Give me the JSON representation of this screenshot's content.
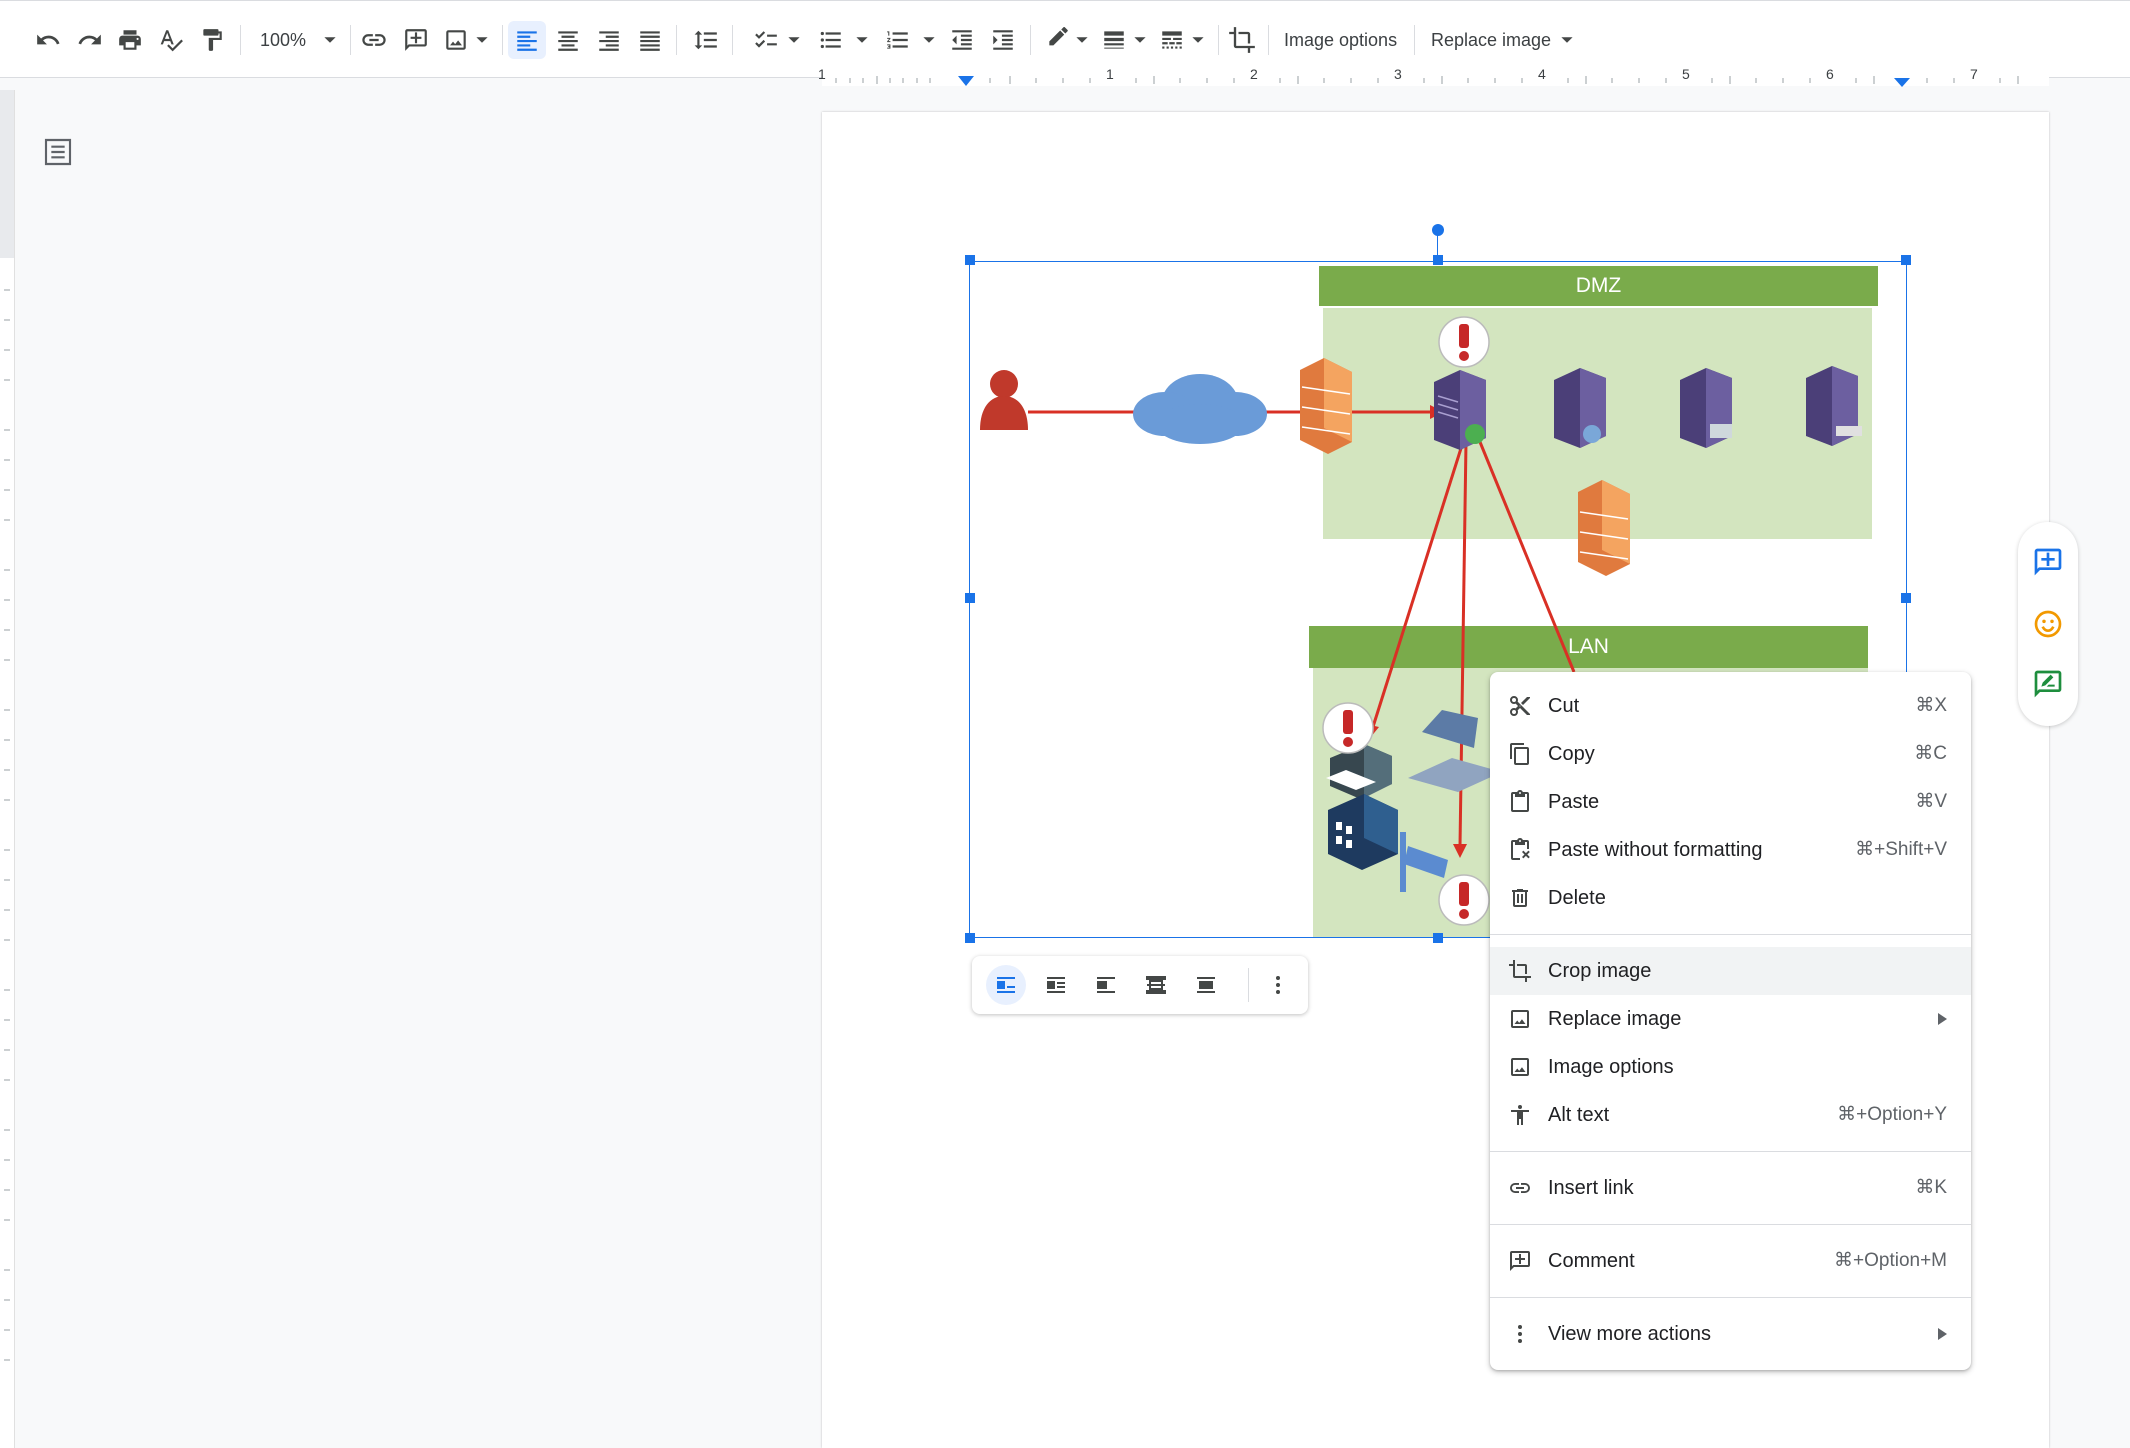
{
  "toolbar": {
    "zoom": "100%",
    "image_options_label": "Image options",
    "replace_image_label": "Replace image"
  },
  "ruler": {
    "numbers": [
      "1",
      "1",
      "2",
      "3",
      "4",
      "5",
      "6",
      "7"
    ]
  },
  "diagram": {
    "dmz_label": "DMZ",
    "lan_label": "LAN"
  },
  "context_menu": {
    "items": [
      {
        "label": "Cut",
        "shortcut": "⌘X",
        "icon": "scissors-icon"
      },
      {
        "label": "Copy",
        "shortcut": "⌘C",
        "icon": "copy-icon"
      },
      {
        "label": "Paste",
        "shortcut": "⌘V",
        "icon": "clipboard-icon"
      },
      {
        "label": "Paste without formatting",
        "shortcut": "⌘+Shift+V",
        "icon": "clipboard-clear-icon"
      },
      {
        "label": "Delete",
        "shortcut": "",
        "icon": "trash-icon"
      },
      {
        "label": "Crop image",
        "shortcut": "",
        "icon": "crop-icon"
      },
      {
        "label": "Replace image",
        "shortcut": "",
        "icon": "image-icon"
      },
      {
        "label": "Image options",
        "shortcut": "",
        "icon": "image-icon"
      },
      {
        "label": "Alt text",
        "shortcut": "⌘+Option+Y",
        "icon": "accessibility-icon"
      },
      {
        "label": "Insert link",
        "shortcut": "⌘K",
        "icon": "link-icon"
      },
      {
        "label": "Comment",
        "shortcut": "⌘+Option+M",
        "icon": "add-comment-icon"
      },
      {
        "label": "View more actions",
        "shortcut": "",
        "icon": "more-vert-icon"
      }
    ]
  },
  "colors": {
    "accent": "#1a73e8",
    "zone_header": "#7aab4b",
    "zone_fill": "#d3e5bf",
    "arrow": "#d93025"
  }
}
